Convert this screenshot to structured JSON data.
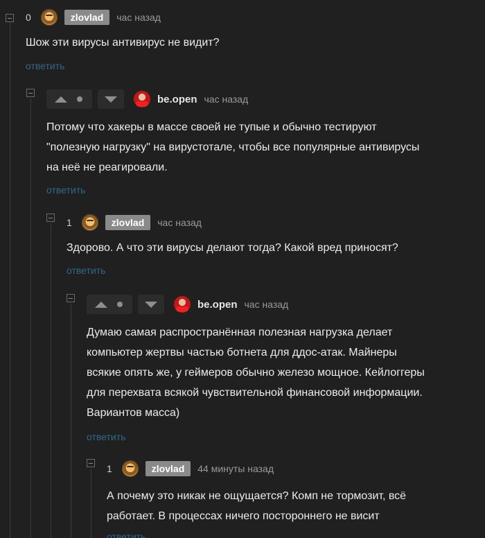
{
  "comments": [
    {
      "rating": "0",
      "author": "zlovlad",
      "time": "час назад",
      "text": "Шож эти вирусы антивирус не видит?",
      "reply": "ответить"
    },
    {
      "author": "be.open",
      "time": "час назад",
      "text_lines": [
        "Потому что хакеры в массе своей не тупые и обычно тестируют",
        "\"полезную нагрузку\" на вирустотале, чтобы все популярные антивирусы",
        "на неё не реагировали."
      ],
      "reply": "ответить"
    },
    {
      "rating": "1",
      "author": "zlovlad",
      "time": "час назад",
      "text": "Здорово. А что эти вирусы делают тогда? Какой вред приносят?",
      "reply": "ответить"
    },
    {
      "author": "be.open",
      "time": "час назад",
      "text_lines": [
        "Думаю самая распространённая полезная нагрузка делает",
        "компьютер жертвы частью ботнета для ддос-атак. Майнеры",
        "всякие опять же, у геймеров обычно железо мощное. Кейлоггеры",
        "для перехвата всякой чувствительной финансовой информации.",
        "Вариантов масса)"
      ],
      "reply": "ответить"
    },
    {
      "rating": "1",
      "author": "zlovlad",
      "time": "44 минуты назад",
      "text_lines": [
        "А почему это никак не ощущается? Комп не тормозит, всё",
        "работает. В процессах ничего постороннего не висит"
      ],
      "reply": "ответить"
    }
  ]
}
